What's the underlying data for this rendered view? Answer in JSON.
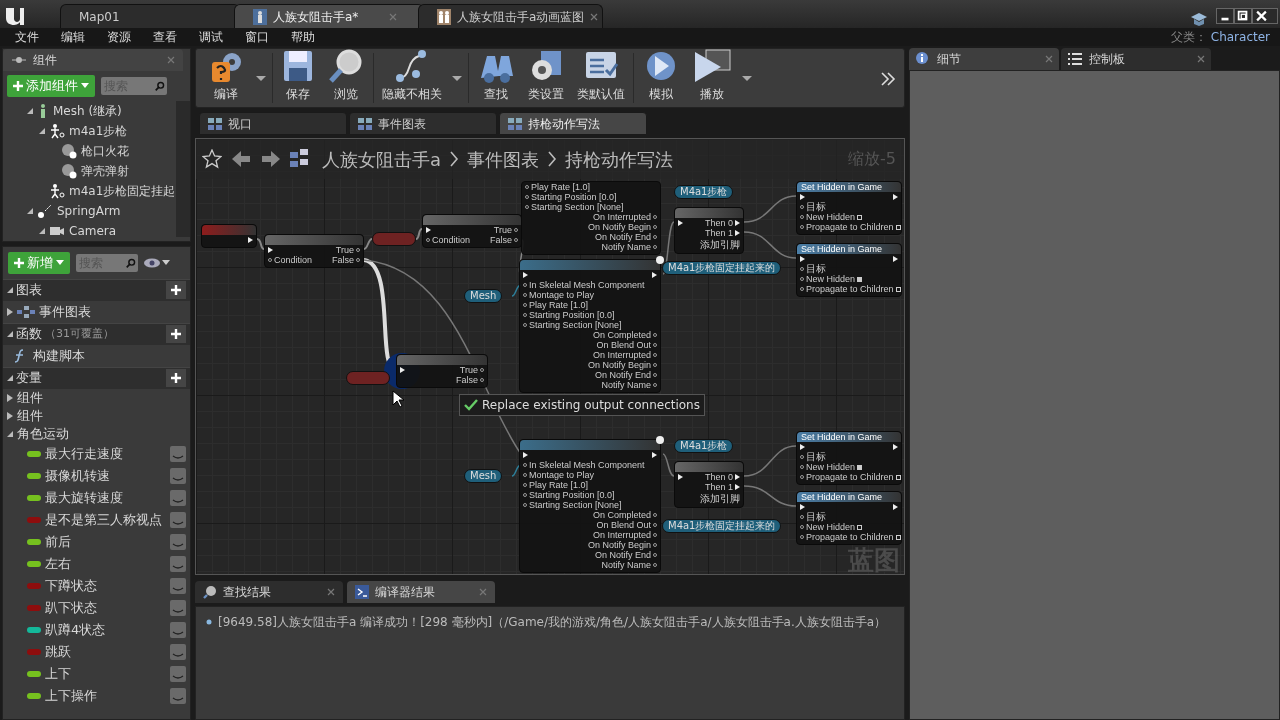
{
  "title_bar": {
    "tabs": [
      {
        "label": "Map01",
        "selected": false,
        "kind": "level"
      },
      {
        "label": "人族女阻击手a*",
        "selected": true,
        "kind": "blueprint"
      },
      {
        "label": "人族女阻击手a动画蓝图",
        "selected": false,
        "kind": "anim"
      }
    ]
  },
  "menu": [
    "文件",
    "编辑",
    "资源",
    "查看",
    "调试",
    "窗口",
    "帮助"
  ],
  "parent_class": {
    "label": "父类：",
    "value": "Character"
  },
  "components_panel": {
    "tab": "组件",
    "add_button": "添加组件",
    "search": {
      "placeholder": "搜索"
    },
    "tree": [
      {
        "label": "Mesh (继承)",
        "kind": "mesh",
        "expanded": true,
        "children": [
          {
            "label": "m4a1步枪",
            "kind": "skeletal",
            "expanded": true,
            "children": [
              {
                "label": "枪口火花",
                "kind": "particle"
              },
              {
                "label": "弹壳弹射",
                "kind": "particle"
              }
            ]
          },
          {
            "label": "m4a1步枪固定挂起",
            "kind": "skeletal"
          }
        ]
      },
      {
        "label": "SpringArm",
        "kind": "spring",
        "expanded": true,
        "children": [
          {
            "label": "Camera",
            "kind": "camera",
            "expanded": true
          }
        ]
      }
    ]
  },
  "my_blueprint": {
    "new_button": "新增",
    "search": {
      "placeholder": "搜索"
    },
    "graphs": {
      "label": "图表",
      "expanded": true,
      "items": [
        {
          "label": "事件图表",
          "expanded": false
        }
      ]
    },
    "functions": {
      "label": "函数",
      "note": "（31可覆盖）",
      "expanded": true,
      "items": [
        {
          "label": "构建脚本"
        }
      ]
    },
    "variables": {
      "label": "变量",
      "expanded": true,
      "categories": [
        {
          "label": "组件",
          "expanded": false
        },
        {
          "label": "组件",
          "expanded": false
        },
        {
          "label": "角色运动",
          "expanded": true,
          "items": [
            {
              "name": "最大行走速度",
              "color": "#76c11f"
            },
            {
              "name": "摄像机转速",
              "color": "#76c11f"
            },
            {
              "name": "最大旋转速度",
              "color": "#76c11f"
            },
            {
              "name": "是不是第三人称视点",
              "color": "#8e0d0d"
            },
            {
              "name": "前后",
              "color": "#76c11f"
            },
            {
              "name": "左右",
              "color": "#76c11f"
            },
            {
              "name": "下蹲状态",
              "color": "#8e0d0d"
            },
            {
              "name": "趴下状态",
              "color": "#8e0d0d"
            },
            {
              "name": "趴蹲4状态",
              "color": "#14b89a"
            },
            {
              "name": "跳跃",
              "color": "#8e0d0d"
            },
            {
              "name": "上下",
              "color": "#76c11f"
            },
            {
              "name": "上下操作",
              "color": "#76c11f"
            }
          ]
        }
      ]
    }
  },
  "toolbar": [
    {
      "label": "编译",
      "kind": "compile",
      "menu": true
    },
    {
      "label": "保存",
      "kind": "save",
      "menu": false
    },
    {
      "label": "浏览",
      "kind": "browse",
      "menu": false
    },
    {
      "label": "隐藏不相关",
      "kind": "hide",
      "menu": true
    },
    {
      "label": "查找",
      "kind": "find",
      "menu": false
    },
    {
      "label": "类设置",
      "kind": "settings",
      "menu": false
    },
    {
      "label": "类默认值",
      "kind": "defaults",
      "menu": false
    },
    {
      "label": "模拟",
      "kind": "simulate",
      "menu": false
    },
    {
      "label": "播放",
      "kind": "play",
      "menu": true
    }
  ],
  "doc_tabs": [
    {
      "label": "视口",
      "selected": false
    },
    {
      "label": "事件图表",
      "selected": false
    },
    {
      "label": "持枪动作写法",
      "selected": true
    }
  ],
  "graph": {
    "breadcrumb": [
      "人族女阻击手a",
      "事件图表",
      "持枪动作写法"
    ],
    "zoom": "缩放-5",
    "corner_label": "蓝图",
    "tooltip": "Replace existing output connections",
    "nodes": [
      {
        "kind": "event"
      },
      {
        "kind": "branch",
        "inputs": [
          "Condition"
        ],
        "outputs": [
          "True",
          "False"
        ]
      },
      {
        "kind": "getter",
        "color": "#6e2222"
      },
      {
        "kind": "branch",
        "inputs": [
          "Condition"
        ],
        "outputs": [
          "True",
          "False"
        ]
      },
      {
        "kind": "getter",
        "label": "Mesh",
        "color": "#1f5f7a"
      },
      {
        "kind": "getter",
        "color": "#6e2222"
      },
      {
        "kind": "branch",
        "outputs": [
          "True",
          "False"
        ]
      },
      {
        "kind": "montage_tail",
        "inputs": [
          "Play Rate [1.0]",
          "Starting Position [0.0]",
          "Starting Section [None]"
        ],
        "outputs": [
          "On Interrupted",
          "On Notify Begin",
          "On Notify End",
          "Notify Name"
        ]
      },
      {
        "kind": "montage",
        "inputs": [
          "In Skeletal Mesh Component",
          "Montage to Play",
          "Play Rate [1.0]",
          "Starting Position [0.0]",
          "Starting Section [None]"
        ],
        "outputs": [
          "On Completed",
          "On Blend Out",
          "On Interrupted",
          "On Notify Begin",
          "On Notify End",
          "Notify Name"
        ]
      },
      {
        "kind": "getter",
        "label": "M4a1步枪",
        "color": "#1f5f7a"
      },
      {
        "kind": "sequence",
        "outputs": [
          "Then 0",
          "Then 1"
        ],
        "add_pin": "添加引脚"
      },
      {
        "kind": "getter",
        "label": "M4a1步枪固定挂起来的",
        "color": "#1f5f7a"
      },
      {
        "kind": "function",
        "title": "Set Hidden in Game",
        "inputs": [
          {
            "label": "目标"
          },
          {
            "label": "New Hidden",
            "checked": false
          },
          {
            "label": "Propagate to Children",
            "checked": false
          }
        ]
      },
      {
        "kind": "function",
        "title": "Set Hidden in Game",
        "inputs": [
          {
            "label": "目标"
          },
          {
            "label": "New Hidden",
            "checked": true
          },
          {
            "label": "Propagate to Children",
            "checked": false
          }
        ]
      },
      {
        "kind": "getter",
        "label": "Mesh",
        "color": "#1f5f7a"
      },
      {
        "kind": "montage",
        "inputs": [
          "In Skeletal Mesh Component",
          "Montage to Play",
          "Play Rate [1.0]",
          "Starting Position [0.0]",
          "Starting Section [None]"
        ],
        "outputs": [
          "On Completed",
          "On Blend Out",
          "On Interrupted",
          "On Notify Begin",
          "On Notify End",
          "Notify Name"
        ]
      },
      {
        "kind": "getter",
        "label": "M4a1步枪",
        "color": "#1f5f7a"
      },
      {
        "kind": "sequence",
        "outputs": [
          "Then 0",
          "Then 1"
        ],
        "add_pin": "添加引脚"
      },
      {
        "kind": "getter",
        "label": "M4a1步枪固定挂起来的",
        "color": "#1f5f7a"
      },
      {
        "kind": "function",
        "title": "Set Hidden in Game",
        "inputs": [
          {
            "label": "目标"
          },
          {
            "label": "New Hidden",
            "checked": true
          },
          {
            "label": "Propagate to Children",
            "checked": false
          }
        ]
      },
      {
        "kind": "function",
        "title": "Set Hidden in Game",
        "inputs": [
          {
            "label": "目标"
          },
          {
            "label": "New Hidden",
            "checked": false
          },
          {
            "label": "Propagate to Children",
            "checked": false
          }
        ]
      }
    ]
  },
  "bottom_tabs": [
    {
      "label": "查找结果",
      "kind": "find",
      "selected": false
    },
    {
      "label": "编译器结果",
      "kind": "compiler",
      "selected": true
    }
  ],
  "log": [
    "[9649.58]人族女阻击手a 编译成功！[298 毫秒内]（/Game/我的游戏/角色/人族女阻击手a/人族女阻击手a.人族女阻击手a）"
  ],
  "details_tabs": [
    {
      "label": "细节",
      "kind": "details",
      "selected": true
    },
    {
      "label": "控制板",
      "kind": "palette",
      "selected": false
    }
  ]
}
